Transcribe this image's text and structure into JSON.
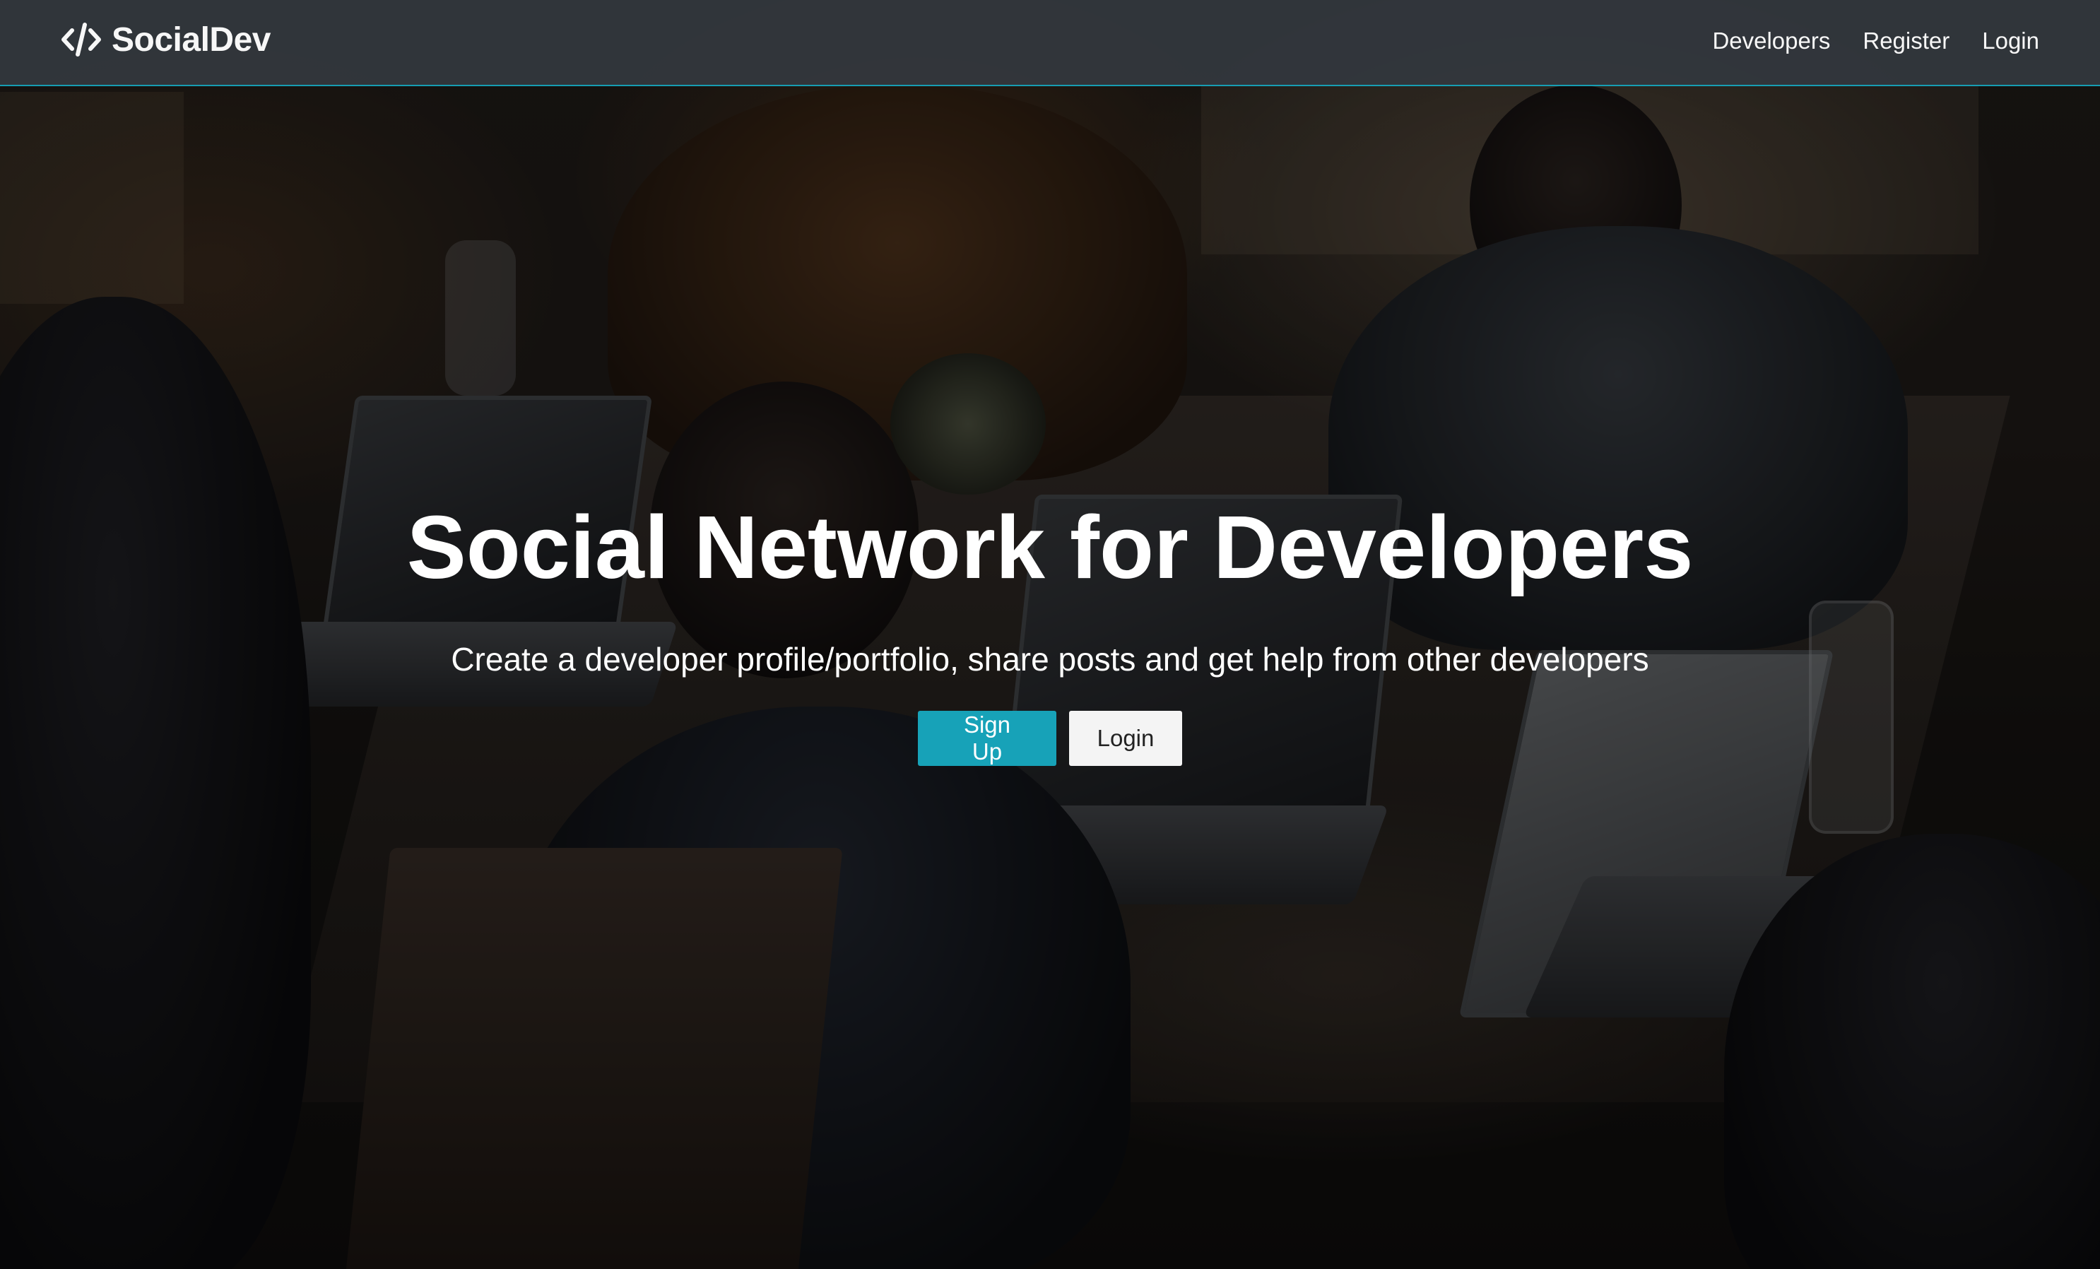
{
  "navbar": {
    "brand_text": "SocialDev",
    "brand_icon": "code-icon",
    "links": [
      {
        "label": "Developers"
      },
      {
        "label": "Register"
      },
      {
        "label": "Login"
      }
    ]
  },
  "hero": {
    "title": "Social Network for Developers",
    "lead": "Create a developer profile/portfolio, share posts and get help from other developers",
    "buttons": {
      "signup_label": "Sign Up",
      "login_label": "Login"
    },
    "background": "photo of developers working on laptops at a table"
  },
  "colors": {
    "accent": "#17a2b8",
    "navbar": "#343a40",
    "light_button": "#f4f4f4"
  }
}
